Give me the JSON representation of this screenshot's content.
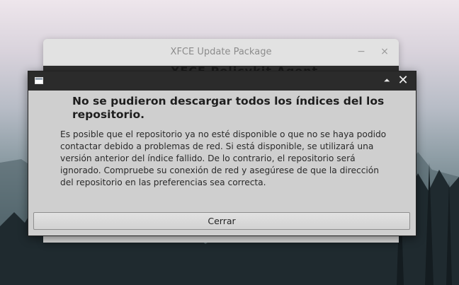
{
  "background_window": {
    "title": "XFCE Update Package",
    "minimize_glyph": "−",
    "close_glyph": "×",
    "partial_text": "XFCE Policykit Agent"
  },
  "dialog": {
    "heading": "No se pudieron descargar todos los índices del los repositorio.",
    "body": "Es posible que el repositorio ya no esté disponible o que no se haya podido contactar debido a problemas de red. Si está disponible, se utilizará una versión anterior del índice fallido. De lo contrario, el repositorio será ignorado. Compruebe su conexión de red y asegúrese de que la dirección del repositorio en las preferencias sea correcta.",
    "button_label": "Cerrar",
    "maximize_glyph": "⏶",
    "close_glyph": "✕"
  },
  "icons": {
    "app_icon": "window-icon",
    "maximize": "maximize-icon",
    "close": "close-icon"
  }
}
